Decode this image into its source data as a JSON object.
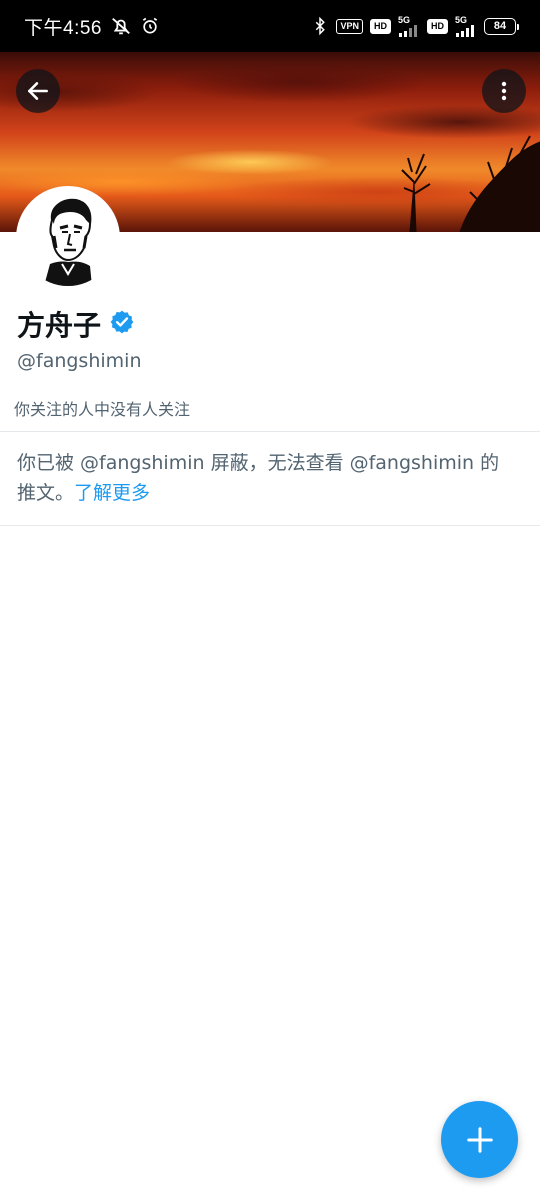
{
  "status_bar": {
    "time": "下午4:56",
    "vpn_label": "VPN",
    "hd_label": "HD",
    "network_label": "5G",
    "battery_level": "84",
    "icons": [
      "mute-icon",
      "alarm-icon",
      "bluetooth-icon",
      "signal-icon",
      "battery-icon"
    ]
  },
  "header": {
    "back_icon": "arrow-left-icon",
    "more_icon": "more-vertical-icon"
  },
  "profile": {
    "display_name": "方舟子",
    "verified": true,
    "handle": "@fangshimin",
    "followers_you_know": "你关注的人中没有人关注"
  },
  "blocked_notice": {
    "text": "你已被 @fangshimin 屏蔽，无法查看 @fangshimin 的推文。",
    "link_label": "了解更多"
  },
  "fab": {
    "icon": "plus-icon"
  },
  "colors": {
    "accent": "#1d9bf0",
    "secondary_text": "#536471",
    "primary_text": "#0f1419"
  }
}
